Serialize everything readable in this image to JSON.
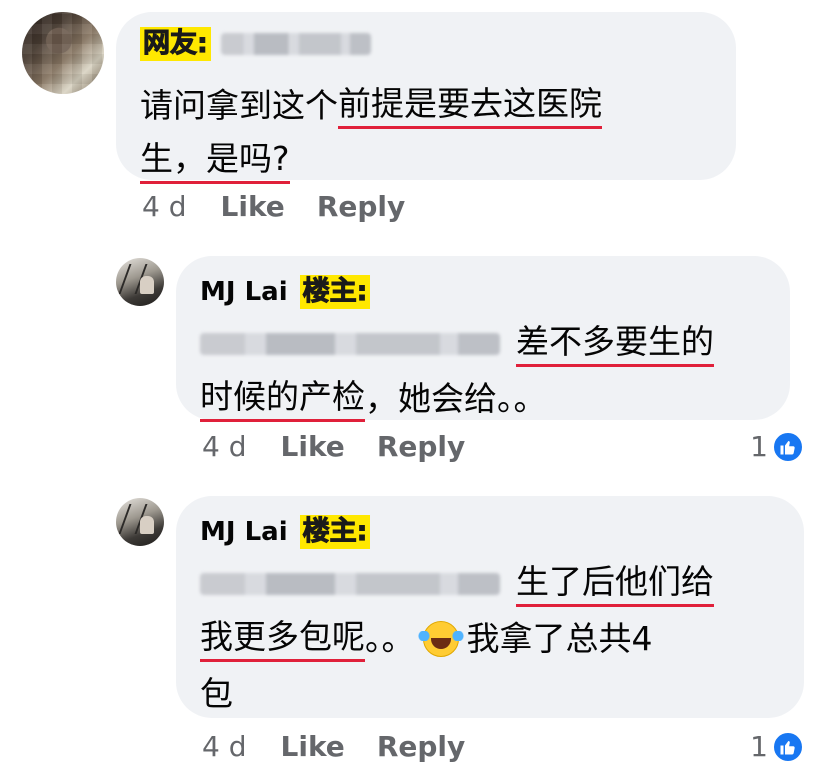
{
  "main_comment": {
    "tag": "网友:",
    "text_line1_plain": "请问拿到这个",
    "text_line1_underlined": "前提是要去这医院",
    "text_line2_underlined": "生，是吗?",
    "time": "4 d",
    "like_label": "Like",
    "reply_label": "Reply"
  },
  "reply1": {
    "author": "MJ Lai",
    "tag": "楼主:",
    "text_line1_underlined": "差不多要生的",
    "text_line2_underlined": "时候的产检",
    "text_line2_plain": "，她会给。。",
    "time": "4 d",
    "like_label": "Like",
    "reply_label": "Reply",
    "like_count": "1"
  },
  "reply2": {
    "author": "MJ Lai",
    "tag": "楼主:",
    "text_line1_underlined": "生了后他们给",
    "text_line2_underlined": "我更多包呢",
    "text_line2_plain_a": "。。",
    "text_line2_plain_b": "我拿了总共4",
    "text_line3_plain": "包",
    "emoji": "face-with-tears-of-joy-icon",
    "time": "4 d",
    "like_label": "Like",
    "reply_label": "Reply",
    "like_count": "1"
  },
  "colors": {
    "bubble_bg": "#f0f2f5",
    "underline": "#e0203a",
    "tag_highlight": "#ffe800",
    "meta_text": "#65676b",
    "like_blue": "#1877f2"
  }
}
